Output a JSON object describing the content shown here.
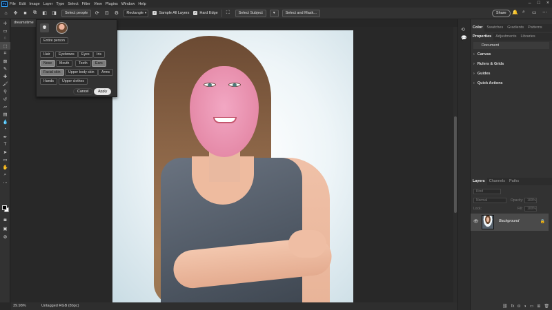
{
  "menubar": {
    "items": [
      "File",
      "Edit",
      "Image",
      "Layer",
      "Type",
      "Select",
      "Filter",
      "View",
      "Plugins",
      "Window",
      "Help"
    ]
  },
  "options": {
    "select_people": "Select people",
    "shape": "Rectangle",
    "sample_all_layers": "Sample All Layers",
    "hard_edge": "Hard Edge",
    "select_subject": "Select Subject",
    "select_and_mask": "Select and Mask...",
    "share": "Share"
  },
  "document": {
    "tab": "dreamstime"
  },
  "popup": {
    "entire_person": "Entire person",
    "parts": [
      "Hair",
      "Eyebrows",
      "Eyes",
      "Iris",
      "Nose",
      "Mouth",
      "Teeth",
      "Ears",
      "Facial skin",
      "Upper body skin",
      "Arms",
      "Hands",
      "Upper clothes"
    ],
    "selected": [
      "Nose",
      "Ears",
      "Facial skin"
    ],
    "cancel": "Cancel",
    "apply": "Apply"
  },
  "status": {
    "zoom": "39.98%",
    "info": "Untagged RGB (8bpc)"
  },
  "right_panel": {
    "top_tabs": [
      "Color",
      "Swatches",
      "Gradients",
      "Patterns"
    ],
    "prop_tabs": [
      "Properties",
      "Adjustments",
      "Libraries"
    ],
    "document_label": "Document",
    "sections": [
      "Canvas",
      "Rulers & Grids",
      "Guides",
      "Quick Actions"
    ],
    "layer_tabs": [
      "Layers",
      "Channels",
      "Paths"
    ],
    "kind": "Kind",
    "blend_mode": "Normal",
    "opacity_label": "Opacity:",
    "opacity_value": "100%",
    "lock_label": "Lock:",
    "fill_label": "Fill:",
    "fill_value": "100%",
    "layer_name": "Background"
  }
}
